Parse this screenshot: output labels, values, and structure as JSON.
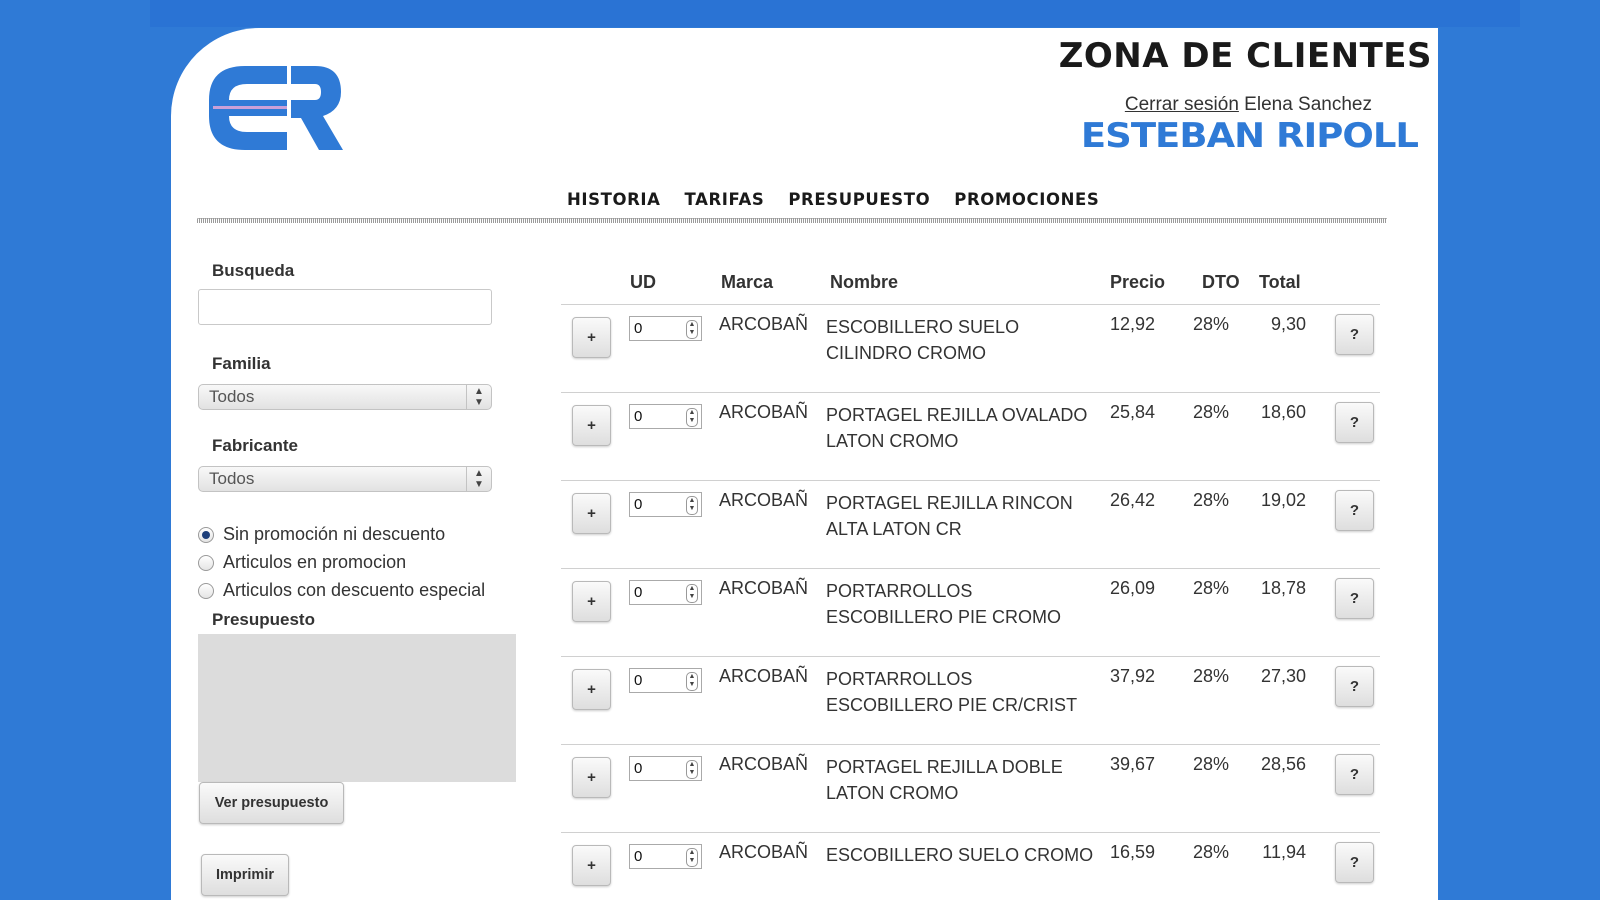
{
  "header": {
    "zone_title": "ZONA DE CLIENTES",
    "logout": "Cerrar sesión",
    "user": "Elena Sanchez",
    "brand": "ESTEBAN RIPOLL"
  },
  "nav": [
    "HISTORIA",
    "TARIFAS",
    "PRESUPUESTO",
    "PROMOCIONES"
  ],
  "sidebar": {
    "search_label": "Busqueda",
    "search_value": "",
    "family_label": "Familia",
    "family_value": "Todos",
    "maker_label": "Fabricante",
    "maker_value": "Todos",
    "filters": [
      {
        "label": "Sin promoción ni descuento",
        "checked": true
      },
      {
        "label": "Articulos en promocion",
        "checked": false
      },
      {
        "label": "Articulos con descuento especial",
        "checked": false
      }
    ],
    "budget_label": "Presupuesto",
    "view_budget_button": "Ver presupuesto",
    "print_button": "Imprimir"
  },
  "table": {
    "headers": {
      "ud": "UD",
      "marca": "Marca",
      "nombre": "Nombre",
      "precio": "Precio",
      "dto": "DTO",
      "total": "Total"
    },
    "rows": [
      {
        "plus": "+",
        "qty": "0",
        "marca": "ARCOBAÑ",
        "nombre": "ESCOBILLERO SUELO CILINDRO CROMO",
        "precio": "12,92",
        "dto": "28%",
        "total": "9,30",
        "help": "?"
      },
      {
        "plus": "+",
        "qty": "0",
        "marca": "ARCOBAÑ",
        "nombre": "PORTAGEL REJILLA OVALADO LATON CROMO",
        "precio": "25,84",
        "dto": "28%",
        "total": "18,60",
        "help": "?"
      },
      {
        "plus": "+",
        "qty": "0",
        "marca": "ARCOBAÑ",
        "nombre": "PORTAGEL REJILLA RINCON ALTA LATON CR",
        "precio": "26,42",
        "dto": "28%",
        "total": "19,02",
        "help": "?"
      },
      {
        "plus": "+",
        "qty": "0",
        "marca": "ARCOBAÑ",
        "nombre": "PORTARROLLOS ESCOBILLERO PIE CROMO",
        "precio": "26,09",
        "dto": "28%",
        "total": "18,78",
        "help": "?"
      },
      {
        "plus": "+",
        "qty": "0",
        "marca": "ARCOBAÑ",
        "nombre": "PORTARROLLOS ESCOBILLERO PIE CR/CRIST",
        "precio": "37,92",
        "dto": "28%",
        "total": "27,30",
        "help": "?"
      },
      {
        "plus": "+",
        "qty": "0",
        "marca": "ARCOBAÑ",
        "nombre": "PORTAGEL REJILLA DOBLE LATON CROMO",
        "precio": "39,67",
        "dto": "28%",
        "total": "28,56",
        "help": "?"
      },
      {
        "plus": "+",
        "qty": "0",
        "marca": "ARCOBAÑ",
        "nombre": "ESCOBILLERO SUELO CROMO",
        "precio": "16,59",
        "dto": "28%",
        "total": "11,94",
        "help": "?"
      }
    ]
  },
  "colors": {
    "background": "#2f7ad6",
    "brand_blue": "#2f7ad6",
    "panel": "#ffffff"
  }
}
